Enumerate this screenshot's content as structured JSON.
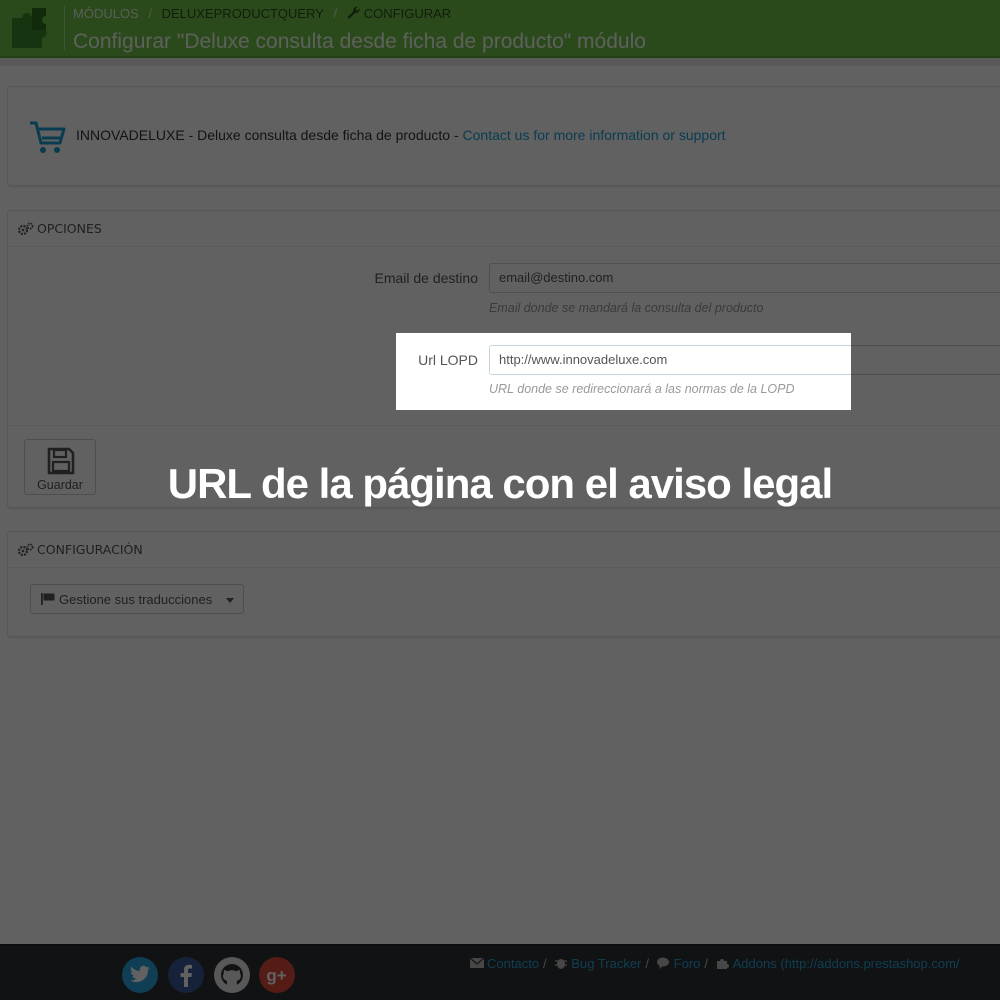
{
  "header": {
    "breadcrumb": [
      "MÓDULOS",
      "DELUXEPRODUCTQUERY",
      "CONFIGURAR"
    ],
    "breadcrumb_separator": "/",
    "title": "Configurar \"Deluxe consulta desde ficha de producto\" módulo",
    "bg_color": "#72c34a"
  },
  "module_info": {
    "brand": "INNOVADELUXE",
    "dash1": "-",
    "description": "Deluxe consulta desde ficha de producto",
    "dash2": "-",
    "contact_link": "Contact us for more information or support"
  },
  "options": {
    "heading": "OPCIONES",
    "email_label": "Email de destino",
    "email_value": "email@destino.com",
    "email_help": "Email donde se mandará la consulta del producto",
    "url_label": "Url LOPD",
    "url_value": "http://www.innovadeluxe.com",
    "url_help": "URL donde se redireccionará a las normas de la LOPD",
    "save_label": "Guardar"
  },
  "configuration": {
    "heading": "CONFIGURACIÓN",
    "translations_button": "Gestione sus traducciones"
  },
  "caption": "URL de la página con el aviso legal",
  "footer": {
    "links": [
      {
        "icon": "envelope-icon",
        "label": "Contacto"
      },
      {
        "icon": "bug-icon",
        "label": "Bug Tracker"
      },
      {
        "icon": "comments-icon",
        "label": "Foro"
      },
      {
        "icon": "puzzle-icon",
        "label": "Addons (http://addons.prestashop.com/"
      }
    ],
    "separator": "/",
    "social": [
      "twitter-icon",
      "facebook-icon",
      "github-icon",
      "google-plus-icon"
    ]
  }
}
